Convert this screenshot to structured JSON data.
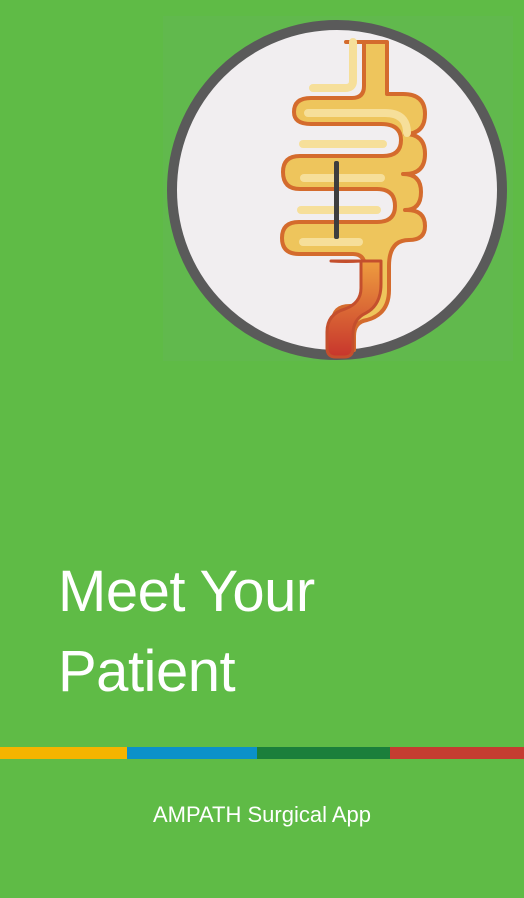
{
  "splash": {
    "title_line1": "Meet Your",
    "title_line2": "Patient",
    "footer_text": "AMPATH Surgical App",
    "logo_icon": "intestine-icon"
  },
  "colors": {
    "background": "#5fbb46",
    "stripe": [
      "#f5b400",
      "#0b91c9",
      "#1b7f3b",
      "#c53c31"
    ],
    "logo_circle_border": "#5a5a5a",
    "logo_circle_fill": "#f1eef0",
    "intestine": "#eec55c",
    "intestine_outline": "#d46b2d"
  }
}
